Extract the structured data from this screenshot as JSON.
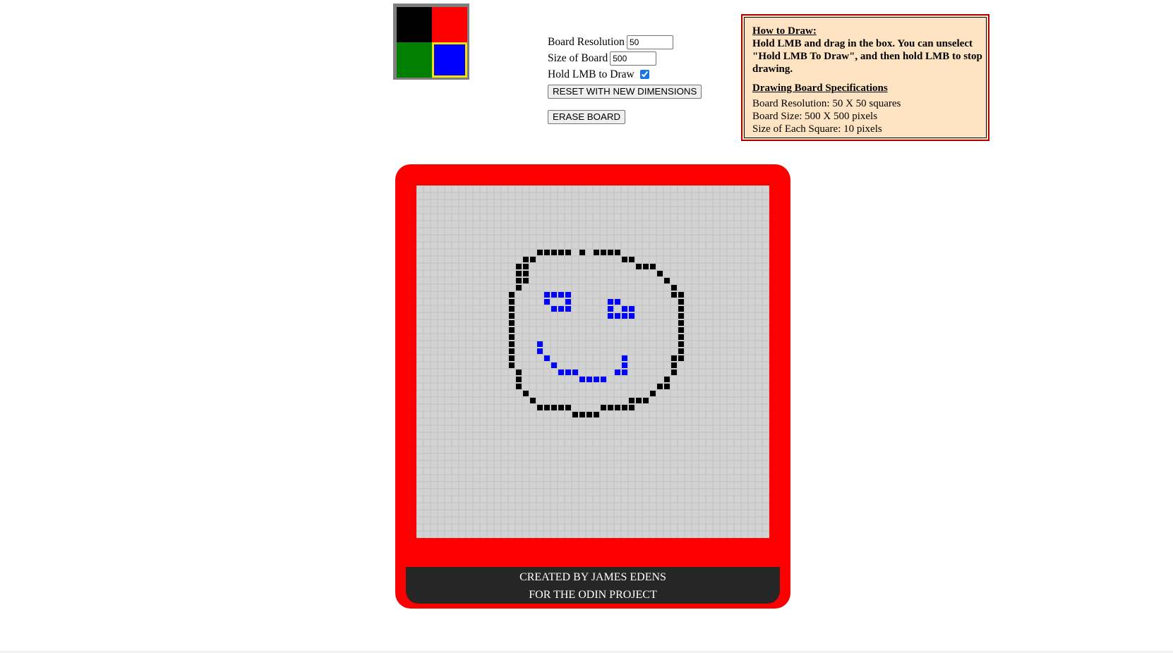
{
  "palette": {
    "colors": [
      "#000000",
      "#fe0000",
      "#027e00",
      "#0000ff"
    ],
    "names": [
      "black",
      "red",
      "green",
      "blue"
    ],
    "selected_index": 3,
    "selected_border": "#f2e300"
  },
  "controls": {
    "resolution_label": "Board Resolution",
    "resolution_value": "50",
    "size_label": "Size of Board",
    "size_value": "500",
    "hold_label": "Hold LMB to Draw",
    "hold_checked": true,
    "reset_label": "RESET WITH NEW DIMENSIONS",
    "erase_label": "ERASE BOARD"
  },
  "info": {
    "how_title": "How to Draw:",
    "how_text": "Hold LMB and drag in the box. You can unselect \"Hold LMB To Draw\", and then hold LMB to stop drawing.",
    "spec_title": "Drawing Board Specifications",
    "spec_resolution": "Board Resolution: 50 X 50 squares",
    "spec_size": "Board Size: 500 X 500 pixels",
    "spec_square": "Size of Each Square: 10 pixels"
  },
  "board": {
    "resolution": 50,
    "background": "#d3d3d3",
    "grid_color": "#c0c0c0",
    "frame_color": "#fc0000",
    "painted": {
      "black": [
        [
          17,
          9
        ],
        [
          18,
          9
        ],
        [
          19,
          9
        ],
        [
          20,
          9
        ],
        [
          21,
          9
        ],
        [
          23,
          9
        ],
        [
          25,
          9
        ],
        [
          26,
          9
        ],
        [
          27,
          9
        ],
        [
          28,
          9
        ],
        [
          15,
          10
        ],
        [
          16,
          10
        ],
        [
          29,
          10
        ],
        [
          30,
          10
        ],
        [
          14,
          11
        ],
        [
          15,
          11
        ],
        [
          31,
          11
        ],
        [
          32,
          11
        ],
        [
          33,
          11
        ],
        [
          14,
          12
        ],
        [
          15,
          12
        ],
        [
          34,
          12
        ],
        [
          14,
          13
        ],
        [
          15,
          13
        ],
        [
          35,
          13
        ],
        [
          14,
          14
        ],
        [
          36,
          14
        ],
        [
          13,
          15
        ],
        [
          36,
          15
        ],
        [
          37,
          15
        ],
        [
          13,
          16
        ],
        [
          37,
          16
        ],
        [
          13,
          17
        ],
        [
          37,
          17
        ],
        [
          13,
          18
        ],
        [
          37,
          18
        ],
        [
          13,
          19
        ],
        [
          37,
          19
        ],
        [
          13,
          20
        ],
        [
          37,
          20
        ],
        [
          13,
          21
        ],
        [
          37,
          21
        ],
        [
          13,
          22
        ],
        [
          37,
          22
        ],
        [
          13,
          23
        ],
        [
          37,
          23
        ],
        [
          13,
          24
        ],
        [
          36,
          24
        ],
        [
          37,
          24
        ],
        [
          13,
          25
        ],
        [
          36,
          25
        ],
        [
          14,
          26
        ],
        [
          36,
          26
        ],
        [
          14,
          27
        ],
        [
          35,
          27
        ],
        [
          14,
          28
        ],
        [
          34,
          28
        ],
        [
          35,
          28
        ],
        [
          15,
          29
        ],
        [
          33,
          29
        ],
        [
          16,
          30
        ],
        [
          30,
          30
        ],
        [
          31,
          30
        ],
        [
          32,
          30
        ],
        [
          17,
          31
        ],
        [
          18,
          31
        ],
        [
          19,
          31
        ],
        [
          20,
          31
        ],
        [
          21,
          31
        ],
        [
          26,
          31
        ],
        [
          27,
          31
        ],
        [
          28,
          31
        ],
        [
          29,
          31
        ],
        [
          30,
          31
        ],
        [
          22,
          32
        ],
        [
          23,
          32
        ],
        [
          24,
          32
        ],
        [
          25,
          32
        ]
      ],
      "blue": [
        [
          18,
          15
        ],
        [
          19,
          15
        ],
        [
          20,
          15
        ],
        [
          21,
          15
        ],
        [
          18,
          16
        ],
        [
          21,
          16
        ],
        [
          27,
          16
        ],
        [
          28,
          16
        ],
        [
          19,
          17
        ],
        [
          20,
          17
        ],
        [
          21,
          17
        ],
        [
          27,
          17
        ],
        [
          29,
          17
        ],
        [
          30,
          17
        ],
        [
          27,
          18
        ],
        [
          28,
          18
        ],
        [
          29,
          18
        ],
        [
          30,
          18
        ],
        [
          17,
          22
        ],
        [
          17,
          23
        ],
        [
          18,
          24
        ],
        [
          19,
          25
        ],
        [
          20,
          26
        ],
        [
          21,
          26
        ],
        [
          22,
          26
        ],
        [
          28,
          26
        ],
        [
          29,
          26
        ],
        [
          23,
          27
        ],
        [
          24,
          27
        ],
        [
          25,
          27
        ],
        [
          26,
          27
        ],
        [
          29,
          25
        ],
        [
          29,
          24
        ]
      ]
    }
  },
  "footer": {
    "line1": "CREATED BY JAMES EDENS",
    "line2": "FOR THE ODIN PROJECT"
  }
}
